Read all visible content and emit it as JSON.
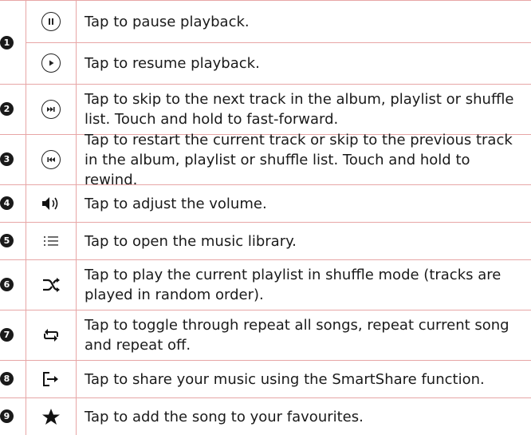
{
  "rows": [
    {
      "badge": "1",
      "items": [
        {
          "icon": "pause-icon",
          "text": "Tap to pause playback."
        },
        {
          "icon": "play-icon",
          "text": "Tap to resume playback."
        }
      ]
    },
    {
      "badge": "2",
      "icon": "skip-next-icon",
      "text": "Tap to skip to the next track in the album, playlist or shuffle list. Touch and hold to fast-forward."
    },
    {
      "badge": "3",
      "icon": "skip-previous-icon",
      "text": "Tap to restart the current track or skip to the previous track in the album, playlist or shuffle list. Touch and hold to rewind."
    },
    {
      "badge": "4",
      "icon": "volume-icon",
      "text": "Tap to adjust the volume."
    },
    {
      "badge": "5",
      "icon": "library-list-icon",
      "text": "Tap to open the music library."
    },
    {
      "badge": "6",
      "icon": "shuffle-icon",
      "text": "Tap to play the current playlist in shuffle mode (tracks are played in random order)."
    },
    {
      "badge": "7",
      "icon": "repeat-icon",
      "text": "Tap to toggle through repeat all songs, repeat current song and repeat off."
    },
    {
      "badge": "8",
      "icon": "share-icon",
      "text": "Tap to share your music using the SmartShare function."
    },
    {
      "badge": "9",
      "icon": "star-icon",
      "text": "Tap to add the song to your favourites."
    }
  ]
}
